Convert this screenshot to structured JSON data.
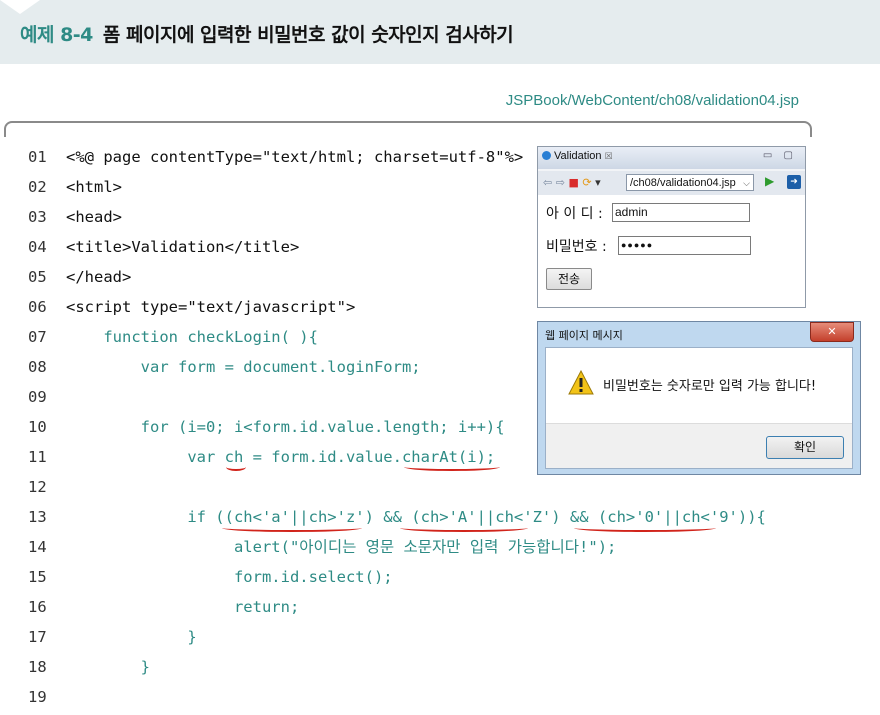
{
  "header": {
    "example_number": "예제 8-4",
    "title": "폼 페이지에 입력한 비밀번호 값이 숫자인지 검사하기"
  },
  "file_path": "JSPBook/WebContent/ch08/validation04.jsp",
  "code_lines": [
    {
      "num": "01",
      "text": "<%@ page contentType=\"text/html; charset=utf-8\"%>"
    },
    {
      "num": "02",
      "text": "<html>"
    },
    {
      "num": "03",
      "text": "<head>"
    },
    {
      "num": "04",
      "text": "<title>Validation</title>"
    },
    {
      "num": "05",
      "text": "</head>"
    },
    {
      "num": "06",
      "text": "<script type=\"text/javascript\">"
    },
    {
      "num": "07",
      "text": "    function checkLogin( ){"
    },
    {
      "num": "08",
      "text": "        var form = document.loginForm;"
    },
    {
      "num": "09",
      "text": ""
    },
    {
      "num": "10",
      "text": "        for (i=0; i<form.id.value.length; i++){"
    },
    {
      "num": "11",
      "text": "             var ch = form.id.value.charAt(i);"
    },
    {
      "num": "12",
      "text": ""
    },
    {
      "num": "13",
      "text": "             if ((ch<'a'||ch>'z') && (ch>'A'||ch<'Z') && (ch>'0'||ch<'9')){"
    },
    {
      "num": "14",
      "text": "                  alert(\"아이디는 영문 소문자만 입력 가능합니다!\");"
    },
    {
      "num": "15",
      "text": "                  form.id.select();"
    },
    {
      "num": "16",
      "text": "                  return;"
    },
    {
      "num": "17",
      "text": "             }"
    },
    {
      "num": "18",
      "text": "        }"
    },
    {
      "num": "19",
      "text": ""
    }
  ],
  "browser": {
    "tab_title": "Validation",
    "tab_close": "☒",
    "window_controls": "▭ ▢",
    "url": "/ch08/validation04.jsp",
    "id_label": "아 이 디 :",
    "id_value": "admin",
    "password_label": "비밀번호 :",
    "password_value": "●●●●●",
    "submit_label": "전송"
  },
  "dialog": {
    "title": "웹 페이지 메시지",
    "close_label": "✕",
    "message": "비밀번호는 숫자로만 입력 가능 합니다!",
    "ok_label": "확인"
  },
  "colors": {
    "accent": "#2e8b85",
    "underline": "#d1241b",
    "header_bg": "#e5ecee"
  }
}
